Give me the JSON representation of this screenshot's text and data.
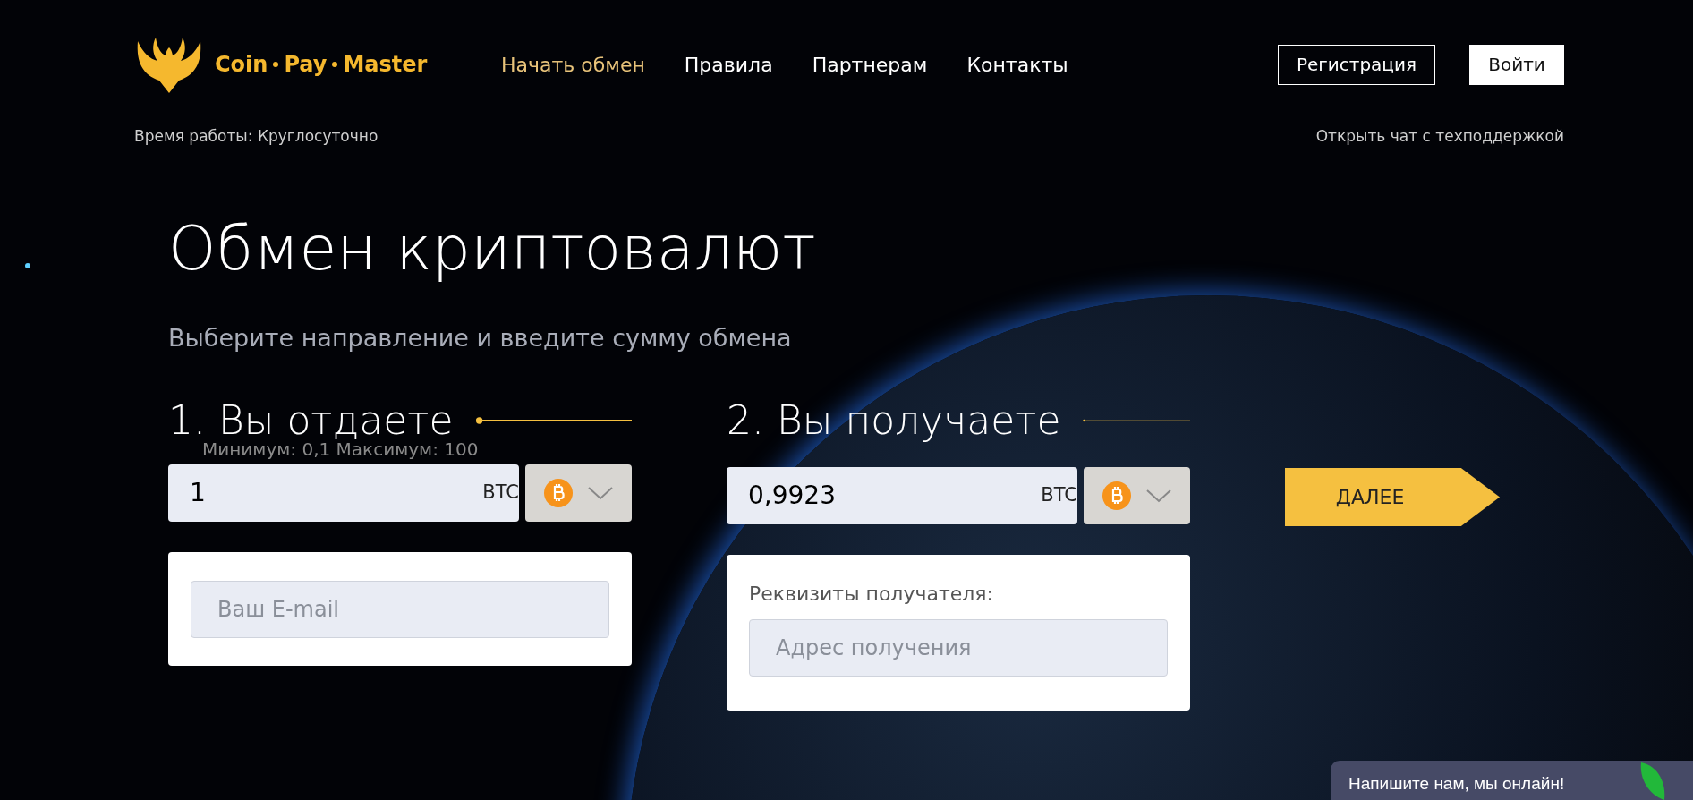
{
  "logo": {
    "text_parts": [
      "Coin",
      "Pay",
      "Master"
    ]
  },
  "nav": [
    {
      "label": "Начать обмен",
      "selected": true
    },
    {
      "label": "Правила",
      "selected": false
    },
    {
      "label": "Партнерам",
      "selected": false
    },
    {
      "label": "Контакты",
      "selected": false
    }
  ],
  "auth_buttons": [
    {
      "label": "Регистрация",
      "kind": "outline"
    },
    {
      "label": "Войти",
      "kind": "solid"
    }
  ],
  "working_hours": "Время работы: Круглосуточно",
  "support_link": "Открыть чат с техподдержкой",
  "title": "Обмен криптовалют",
  "subtitle": "Выберите направление и введите сумму обмена",
  "give": {
    "heading": "1. Вы отдаете",
    "limits": "Минимум: 0,1 Максимум: 100",
    "amount": "1",
    "currency": "BTC",
    "email_placeholder": "Ваш E-mail"
  },
  "receive": {
    "heading": "2. Вы получаете",
    "amount": "0,9923",
    "currency": "BTC",
    "details_label": "Реквизиты получателя:",
    "address_placeholder": "Адрес получения"
  },
  "next_button": "ДАЛЕЕ",
  "chat_widget": "Напишите нам, мы онлайн!"
}
